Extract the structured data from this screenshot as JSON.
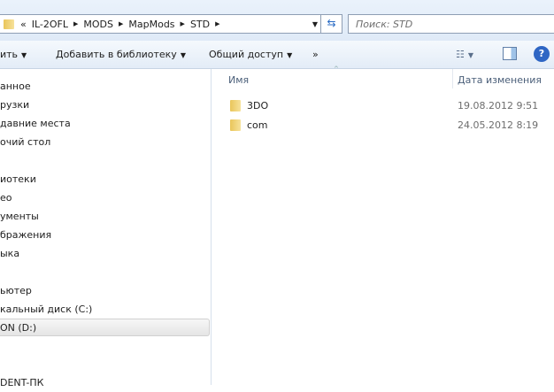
{
  "address_bar": {
    "overflow": "«",
    "crumbs": [
      "IL-2OFL",
      "MODS",
      "MapMods",
      "STD"
    ]
  },
  "search": {
    "placeholder": "Поиск: STD"
  },
  "toolbar": {
    "organize": "ить",
    "add_to_library": "Добавить в библиотеку",
    "share": "Общий доступ",
    "more": "»"
  },
  "sidebar": {
    "items": [
      "анное",
      "рузки",
      "давние места",
      "очий стол",
      "иотеки",
      "ео",
      "ументы",
      "бражения",
      "ыка",
      "ьютер",
      "кальный диск (C:)",
      "ON (D:)",
      "DENT-ПК"
    ]
  },
  "columns": {
    "name": "Имя",
    "date": "Дата изменения"
  },
  "files": [
    {
      "name": "3DO",
      "date": "19.08.2012 9:51"
    },
    {
      "name": "com",
      "date": "24.05.2012 8:19"
    }
  ]
}
